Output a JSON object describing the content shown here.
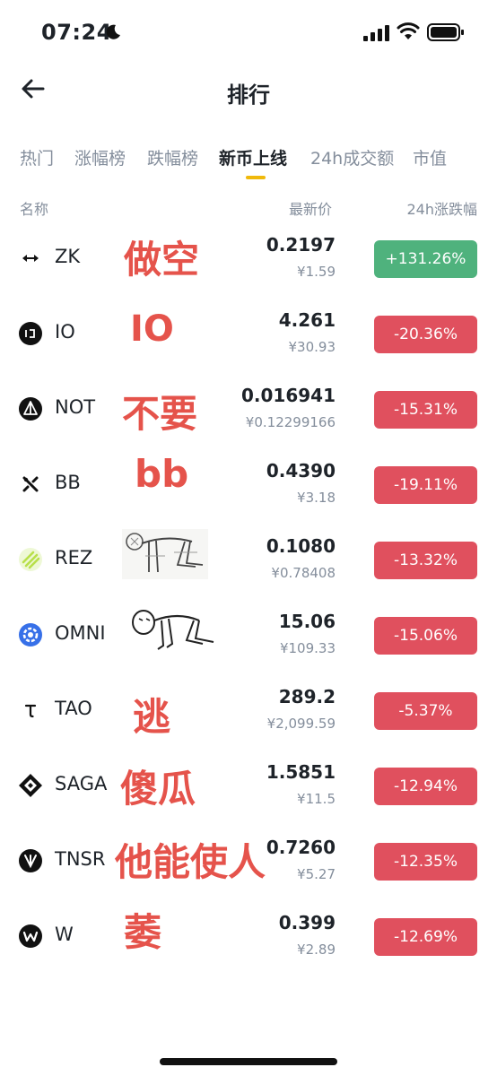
{
  "status_bar": {
    "time": "07:24"
  },
  "nav": {
    "title": "排行"
  },
  "tabs": [
    {
      "label": "热门"
    },
    {
      "label": "涨幅榜"
    },
    {
      "label": "跌幅榜"
    },
    {
      "label": "新币上线",
      "active": true
    },
    {
      "label": "24h成交额"
    },
    {
      "label": "市值"
    }
  ],
  "columns": {
    "name": "名称",
    "price": "最新价",
    "change": "24h涨跌幅"
  },
  "rows": [
    {
      "symbol": "ZK",
      "price": "0.2197",
      "cny": "¥1.59",
      "change": "+131.26%",
      "direction": "up"
    },
    {
      "symbol": "IO",
      "price": "4.261",
      "cny": "¥30.93",
      "change": "-20.36%",
      "direction": "down"
    },
    {
      "symbol": "NOT",
      "price": "0.016941",
      "cny": "¥0.12299166",
      "change": "-15.31%",
      "direction": "down"
    },
    {
      "symbol": "BB",
      "price": "0.4390",
      "cny": "¥3.18",
      "change": "-19.11%",
      "direction": "down"
    },
    {
      "symbol": "REZ",
      "price": "0.1080",
      "cny": "¥0.78408",
      "change": "-13.32%",
      "direction": "down"
    },
    {
      "symbol": "OMNI",
      "price": "15.06",
      "cny": "¥109.33",
      "change": "-15.06%",
      "direction": "down"
    },
    {
      "symbol": "TAO",
      "price": "289.2",
      "cny": "¥2,099.59",
      "change": "-5.37%",
      "direction": "down"
    },
    {
      "symbol": "SAGA",
      "price": "1.5851",
      "cny": "¥11.5",
      "change": "-12.94%",
      "direction": "down"
    },
    {
      "symbol": "TNSR",
      "price": "0.7260",
      "cny": "¥5.27",
      "change": "-12.35%",
      "direction": "down"
    },
    {
      "symbol": "W",
      "price": "0.399",
      "cny": "¥2.89",
      "change": "-12.69%",
      "direction": "down"
    }
  ],
  "annotations": [
    {
      "text": "做空"
    },
    {
      "text": "IO"
    },
    {
      "text": "不要"
    },
    {
      "text": "bb"
    },
    {
      "text": "逃"
    },
    {
      "text": "傻瓜"
    },
    {
      "text": "他能使人"
    },
    {
      "text": "萎"
    }
  ],
  "colors": {
    "up": "#4fb27d",
    "down": "#e0505e",
    "accent": "#f0b90b",
    "annotation": "#e5534b"
  }
}
